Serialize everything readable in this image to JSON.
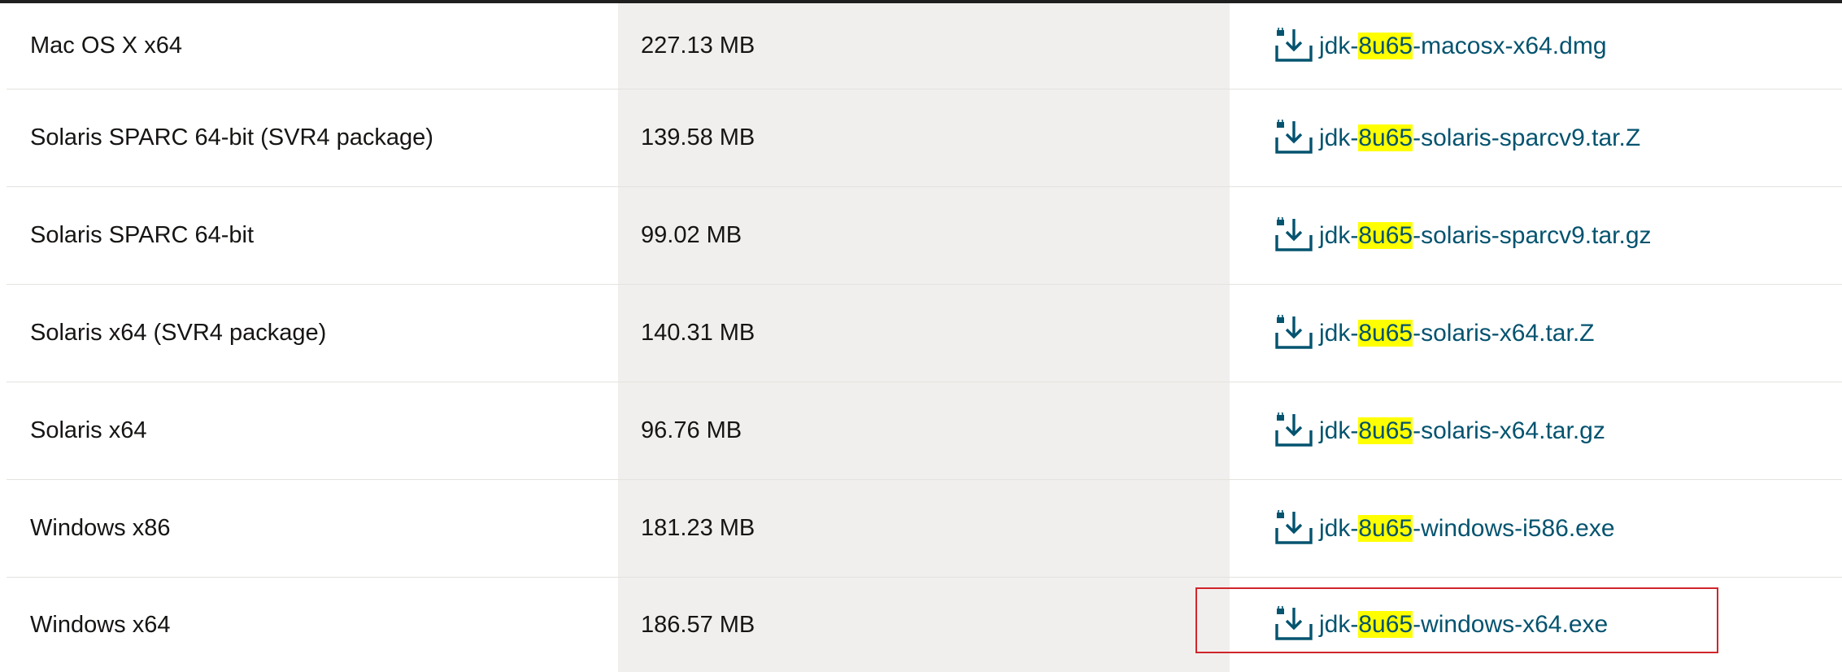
{
  "rows": [
    {
      "platform": "Mac OS X x64",
      "size": "227.13 MB",
      "file_prefix": "jdk-",
      "file_highlight": "8u65",
      "file_suffix": "-macosx-x64.dmg"
    },
    {
      "platform": "Solaris SPARC 64-bit (SVR4 package)",
      "size": "139.58 MB",
      "file_prefix": "jdk-",
      "file_highlight": "8u65",
      "file_suffix": "-solaris-sparcv9.tar.Z"
    },
    {
      "platform": "Solaris SPARC 64-bit",
      "size": "99.02 MB",
      "file_prefix": "jdk-",
      "file_highlight": "8u65",
      "file_suffix": "-solaris-sparcv9.tar.gz"
    },
    {
      "platform": "Solaris x64 (SVR4 package)",
      "size": "140.31 MB",
      "file_prefix": "jdk-",
      "file_highlight": "8u65",
      "file_suffix": "-solaris-x64.tar.Z"
    },
    {
      "platform": "Solaris x64",
      "size": "96.76 MB",
      "file_prefix": "jdk-",
      "file_highlight": "8u65",
      "file_suffix": "-solaris-x64.tar.gz"
    },
    {
      "platform": "Windows x86",
      "size": "181.23 MB",
      "file_prefix": "jdk-",
      "file_highlight": "8u65",
      "file_suffix": "-windows-i586.exe"
    },
    {
      "platform": "Windows x64",
      "size": "186.57 MB",
      "file_prefix": "jdk-",
      "file_highlight": "8u65",
      "file_suffix": "-windows-x64.exe"
    }
  ],
  "colors": {
    "link": "#04536f",
    "highlight": "#ffff00",
    "size_column_bg": "#f1efed",
    "selection_box": "#d0252b"
  },
  "icons": {
    "download": "locked-download-icon"
  },
  "selected_row": 6
}
